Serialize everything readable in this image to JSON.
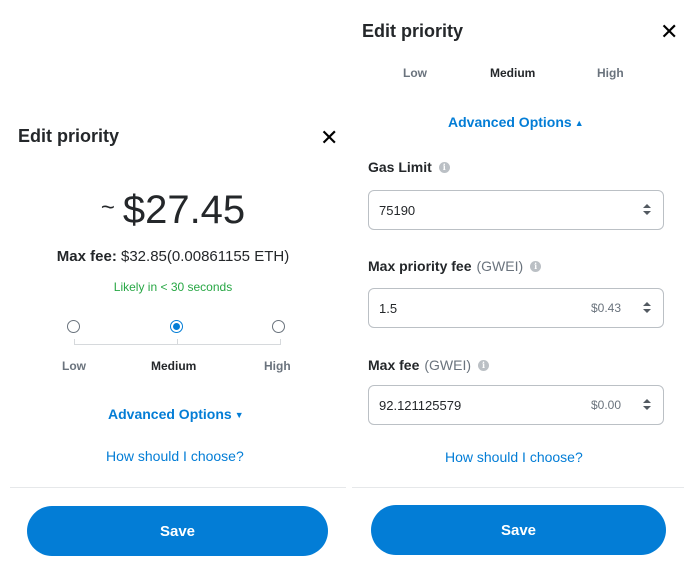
{
  "left": {
    "title": "Edit priority",
    "close_glyph": "✕",
    "estimate_prefix": "~",
    "estimate": "$27.45",
    "max_fee_label": "Max fee:",
    "max_fee_fiat": "$32.85",
    "max_fee_eth": "(0.00861155 ETH)",
    "likely": "Likely in < 30 seconds",
    "levels": [
      {
        "label": "Low",
        "selected": false
      },
      {
        "label": "Medium",
        "selected": true
      },
      {
        "label": "High",
        "selected": false
      }
    ],
    "advanced_label": "Advanced Options",
    "advanced_caret": "▼",
    "help_link": "How should I choose?",
    "save_label": "Save"
  },
  "right": {
    "title": "Edit priority",
    "close_glyph": "✕",
    "tabs": [
      {
        "label": "Low",
        "active": false
      },
      {
        "label": "Medium",
        "active": true
      },
      {
        "label": "High",
        "active": false
      }
    ],
    "advanced_label": "Advanced Options",
    "advanced_caret": "▲",
    "gas_limit": {
      "label": "Gas Limit",
      "value": "75190"
    },
    "max_priority_fee": {
      "label": "Max priority fee",
      "unit": "(GWEI)",
      "value": "1.5",
      "fiat": "$0.43"
    },
    "max_fee": {
      "label": "Max fee",
      "unit": "(GWEI)",
      "value": "92.121125579",
      "fiat": "$0.00"
    },
    "help_link": "How should I choose?",
    "save_label": "Save"
  },
  "colors": {
    "accent": "#037dd6",
    "success": "#28a745",
    "text": "#24272a",
    "muted": "#6a737d"
  }
}
